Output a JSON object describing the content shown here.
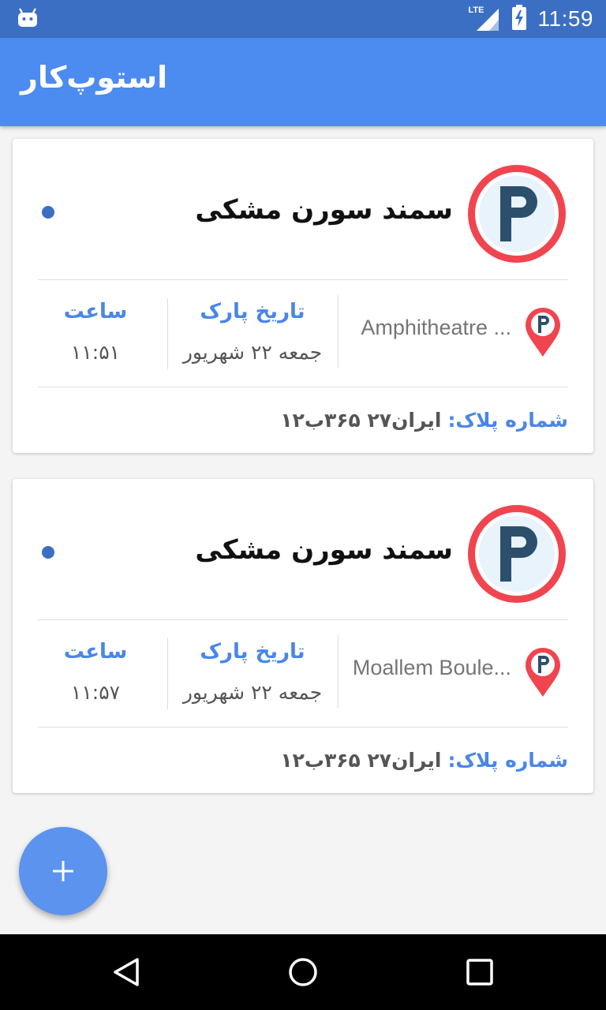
{
  "status_bar": {
    "time": "11:59",
    "network": "LTE",
    "icons": [
      "android-icon",
      "lte-signal-icon",
      "battery-charging-icon"
    ]
  },
  "app_bar": {
    "title": "استوپ‌کار"
  },
  "parkings": [
    {
      "car_name": "سمند سورن مشکی",
      "location": "Amphitheatre ...",
      "date_label": "تاریخ پارک",
      "date_value": "جمعه ۲۲ شهریور",
      "time_label": "ساعت",
      "time_value": "۱۱:۵۱",
      "plate_label": "شماره پلاک:",
      "plate_value": "ایران۲۷ ۳۶۵ب۱۲"
    },
    {
      "car_name": "سمند سورن مشکی",
      "location": "Moallem Boule...",
      "date_label": "تاریخ پارک",
      "date_value": "جمعه ۲۲ شهریور",
      "time_label": "ساعت",
      "time_value": "۱۱:۵۷",
      "plate_label": "شماره پلاک:",
      "plate_value": "ایران۲۷ ۳۶۵ب۱۲"
    }
  ],
  "fab": {
    "icon": "plus-icon"
  },
  "colors": {
    "status_bar": "#3b6fc4",
    "app_bar": "#4c8bf0",
    "accent": "#4a86e8",
    "fab": "#5b93ef",
    "badge_ring": "#f0454f",
    "badge_letter": "#2c4f6c"
  }
}
